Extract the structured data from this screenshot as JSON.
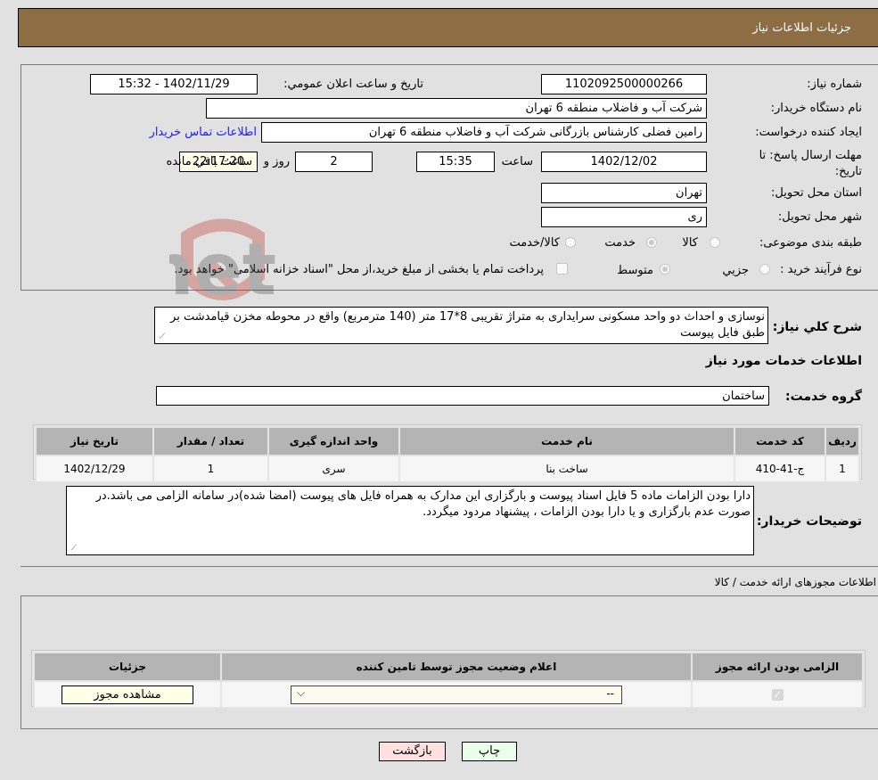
{
  "header": {
    "title": "جزئیات اطلاعات نیاز"
  },
  "form": {
    "need_number_label": "شماره نیاز:",
    "need_number": "1102092500000266",
    "announce_label": "تاریخ و ساعت اعلان عمومي:",
    "announce_value": "1402/11/29 - 15:32",
    "buyer_org_label": "نام دستگاه خریدار:",
    "buyer_org": "شرکت آب و فاضلاب منطقه 6 تهران",
    "creator_label": "ایجاد کننده درخواست:",
    "creator": "رامین  فضلی کارشناس بازرگانی شرکت آب و فاضلاب منطقه 6 تهران",
    "contact_link": "اطلاعات تماس خریدار",
    "deadline_label": "مهلت ارسال پاسخ: تا تاریخ:",
    "deadline_date": "1402/12/02",
    "time_label": "ساعت",
    "deadline_time": "15:35",
    "days_value": "2",
    "days_label": "روز و",
    "remaining_time": "22:17:20",
    "remaining_label": "ساعت باقي مانده",
    "province_label": "استان محل تحویل:",
    "province": "تهران",
    "city_label": "شهر محل تحویل:",
    "city": "ری",
    "category_label": "طبقه بندی موضوعی:",
    "category_options": [
      "کالا",
      "خدمت",
      "کالا/خدمت"
    ],
    "category_selected": "خدمت",
    "process_label": "نوع فرآیند خرید :",
    "process_options": [
      "جزيي",
      "متوسط"
    ],
    "process_selected": "متوسط",
    "treasury_note": "پرداخت تمام یا بخشی از مبلغ خرید،از محل \"اسناد خزانه اسلامی\" خواهد بود."
  },
  "description": {
    "label": "شرح كلي نياز:",
    "text": "نوسازی و احداث دو واحد مسکونی سرایداری به متراژ تقریبی 8*17 متر (140 مترمربع) واقع در محوطه مخزن قیامدشت بر طبق فایل پیوست"
  },
  "services": {
    "section_title": "اطلاعات خدمات مورد نیاز",
    "group_label": "گروه خدمت:",
    "group_value": "ساختمان",
    "columns": [
      "ردیف",
      "کد خدمت",
      "نام خدمت",
      "واحد اندازه گیری",
      "تعداد / مقدار",
      "تاریخ نیاز"
    ],
    "rows": [
      {
        "row": "1",
        "code": "ج-41-410",
        "name": "ساخت بنا",
        "unit": "سری",
        "qty": "1",
        "date": "1402/12/29"
      }
    ]
  },
  "buyer_notes": {
    "label": "توضیحات خریدار:",
    "text": "دارا بودن الزامات ماده 5 فایل اسناد پیوست و بارگزاری این مدارک به همراه فایل های پیوست (امضا شده)در سامانه الزامی می باشد.در صورت عدم بارگزاری و یا دارا بودن الزامات ، پیشنهاد مردود میگردد."
  },
  "licenses": {
    "section_title": "اطلاعات مجوزهای ارائه خدمت / کالا",
    "columns": [
      "الزامی بودن ارائه مجوز",
      "اعلام وضعیت مجوز توسط تامین کننده",
      "جزئیات"
    ],
    "row": {
      "required_checked": true,
      "status_value": "--",
      "details_button": "مشاهده مجوز"
    }
  },
  "footer": {
    "print_button": "چاپ",
    "back_button": "بازگشت"
  },
  "watermark": {
    "text": "AriaTender.net"
  },
  "colors": {
    "header_bg": "#8c6d44",
    "back_bg": "#ffe0e0",
    "print_bg": "#eaffea",
    "link": "#1a1aff"
  }
}
